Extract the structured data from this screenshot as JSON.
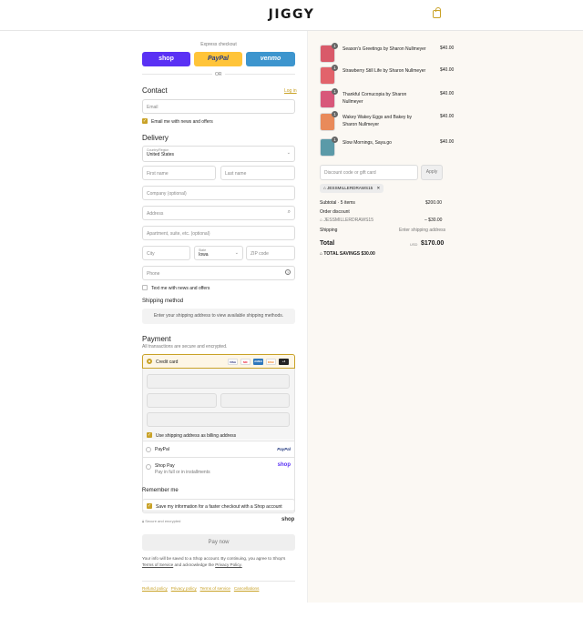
{
  "header": {
    "logo": "JIGGY"
  },
  "express": {
    "label": "Express checkout",
    "shop": "shop",
    "paypal": "PayPal",
    "venmo": "venmo",
    "or": "OR"
  },
  "contact": {
    "title": "Contact",
    "login": "Log in",
    "email_placeholder": "Email",
    "news_label": "Email me with news and offers"
  },
  "delivery": {
    "title": "Delivery",
    "country_label": "Country/Region",
    "country_value": "United States",
    "first_name": "First name",
    "last_name": "Last name",
    "company": "Company (optional)",
    "address": "Address",
    "apartment": "Apartment, suite, etc. (optional)",
    "city": "City",
    "state_label": "State",
    "state_value": "Iowa",
    "zip": "ZIP code",
    "phone": "Phone",
    "text_label": "Text me with news and offers"
  },
  "shipping": {
    "title": "Shipping method",
    "notice": "Enter your shipping address to view available shipping methods."
  },
  "payment": {
    "title": "Payment",
    "subtitle": "All transactions are secure and encrypted.",
    "credit_card": "Credit card",
    "card_logos": [
      "VISA",
      "MC",
      "AMEX",
      "DISC",
      "+4"
    ],
    "billing_label": "Use shipping address as billing address",
    "paypal_label": "PayPal",
    "paypal_logo": "PayPal",
    "shoppay_label": "Shop Pay",
    "shoppay_sub": "Pay in full or in installments",
    "shoppay_logo": "shop"
  },
  "remember": {
    "title": "Remember me",
    "save_label": "Save my information for a faster checkout with a Shop account",
    "secure": "Secure and encrypted",
    "shop_logo": "shop"
  },
  "pay": {
    "button": "Pay now",
    "legal1": "Your info will be saved to a Shop account. By continuing, you agree to Shop's",
    "tos": "Terms of Service",
    "legal2": "and acknowledge the",
    "privacy": "Privacy Policy."
  },
  "footer": {
    "links": [
      "Refund policy",
      "Privacy policy",
      "Terms of service",
      "Cancellations"
    ]
  },
  "cart": {
    "items": [
      {
        "name": "Season's Greetings by Sharon Nullmeyer",
        "price": "$40.00",
        "qty": "1",
        "color": "#d95a6a"
      },
      {
        "name": "Strawberry Still Life by Sharon Nullmeyer",
        "price": "$40.00",
        "qty": "1",
        "color": "#e2636b"
      },
      {
        "name": "Thankful Cornucopia by Sharon Nullmeyer",
        "price": "$40.00",
        "qty": "1",
        "color": "#d8577a"
      },
      {
        "name": "Wakey Wakey Eggs and Bakey by Sharon Nullmeyer",
        "price": "$40.00",
        "qty": "1",
        "color": "#e98a5a"
      },
      {
        "name": "Slow Mornings, Saya.go",
        "price": "$40.00",
        "qty": "1",
        "color": "#5b9aa8"
      }
    ],
    "discount_placeholder": "Discount code or gift card",
    "apply": "Apply",
    "code_tag": "JESSMILLERDRAWS15",
    "subtotal_label": "Subtotal · 5 items",
    "subtotal": "$200.00",
    "order_discount": "Order discount",
    "discount_code": "JESSMILLERDRAWS15",
    "discount_amount": "– $30.00",
    "shipping_label": "Shipping",
    "shipping_value": "Enter shipping address",
    "total_label": "Total",
    "currency": "USD",
    "total": "$170.00",
    "savings": "TOTAL SAVINGS",
    "savings_amount": "$30.00"
  },
  "colors": {
    "accent": "#c9a227",
    "shop": "#5a31f4",
    "paypal": "#ffc439",
    "venmo": "#3d95ce"
  }
}
